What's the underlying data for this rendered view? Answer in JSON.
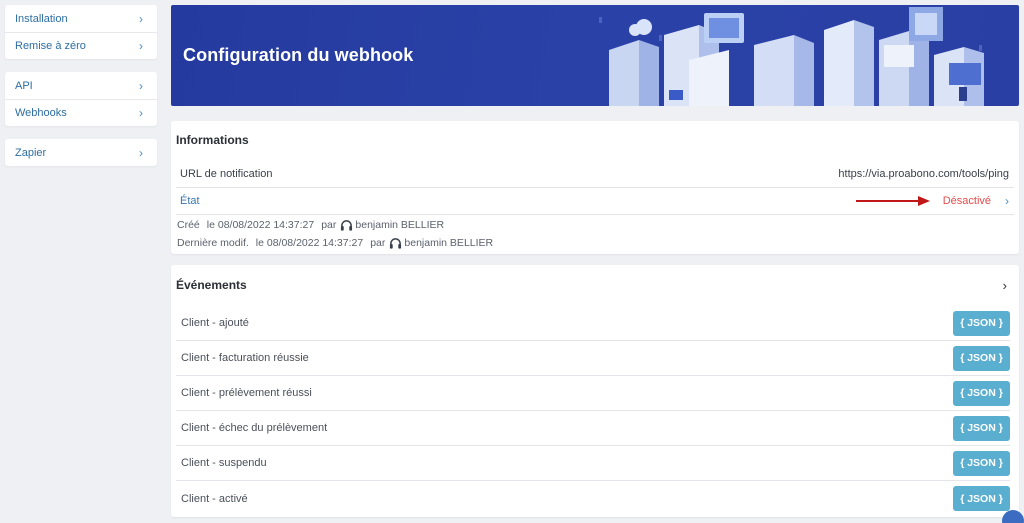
{
  "sidebar": {
    "groups": [
      {
        "items": [
          {
            "label": "Installation"
          },
          {
            "label": "Remise à zéro"
          }
        ]
      },
      {
        "items": [
          {
            "label": "API"
          },
          {
            "label": "Webhooks"
          }
        ]
      },
      {
        "items": [
          {
            "label": "Zapier"
          }
        ]
      }
    ],
    "chevron": "›"
  },
  "banner": {
    "title": "Configuration du webhook"
  },
  "info": {
    "title": "Informations",
    "url_label": "URL de notification",
    "url_value": "https://via.proabono.com/tools/ping",
    "state_label": "État",
    "state_value": "Désactivé",
    "created_label": "Créé",
    "created_date": "le 08/08/2022 14:37:27",
    "modified_label": "Dernière modif.",
    "modified_date": "le 08/08/2022 14:37:27",
    "by_label": "par",
    "author": "benjamin BELLIER"
  },
  "events": {
    "title": "Événements",
    "button_label": "{ JSON }",
    "items": [
      {
        "label": "Client - ajouté"
      },
      {
        "label": "Client - facturation réussie"
      },
      {
        "label": "Client - prélèvement réussi"
      },
      {
        "label": "Client - échec du prélèvement"
      },
      {
        "label": "Client - suspendu"
      },
      {
        "label": "Client - activé"
      }
    ]
  },
  "colors": {
    "banner": "#2a42a8",
    "link": "#2d6ea3",
    "danger": "#e34b4b",
    "json_button": "#5aaed0",
    "annotation_arrow": "#c01818"
  },
  "icons": [
    "chevron-right-icon",
    "headset-icon",
    "annotation-arrow"
  ]
}
